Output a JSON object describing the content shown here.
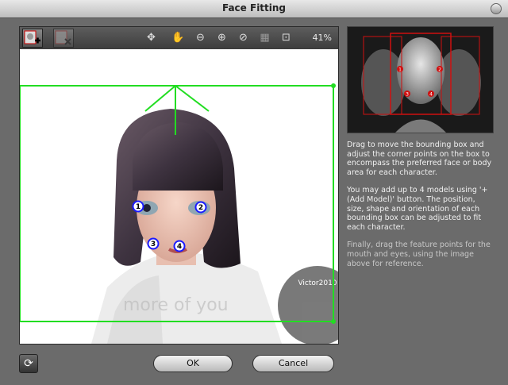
{
  "window": {
    "title": "Face Fitting"
  },
  "toolbar": {
    "zoom": "41%",
    "tools": [
      "add-model-icon",
      "remove-model-icon",
      "select-move-icon",
      "pan-hand-icon",
      "zoom-out-icon",
      "zoom-in-icon",
      "reset-icon",
      "fit-view-icon",
      "fit-box-icon"
    ]
  },
  "feature_points": {
    "p1": "1",
    "p2": "2",
    "p3": "3",
    "p4": "4"
  },
  "watermark": {
    "text": "more of you: Victor2010"
  },
  "instructions": {
    "para1": "Drag to move the bounding box and adjust the corner points on the box to encompass the preferred face or body area for each character.",
    "para2": "You may add up to 4 models using '+ (Add Model)' button. The position, size, shape and orientation of each bounding box can be adjusted to fit each character.",
    "para3": "Finally, drag the feature points for the mouth and eyes, using the image above for reference."
  },
  "buttons": {
    "ok": "OK",
    "cancel": "Cancel"
  },
  "colors": {
    "bounding_box": "#22dd22",
    "feature_point": "#1a1aff",
    "preview_box": "#d01010"
  }
}
